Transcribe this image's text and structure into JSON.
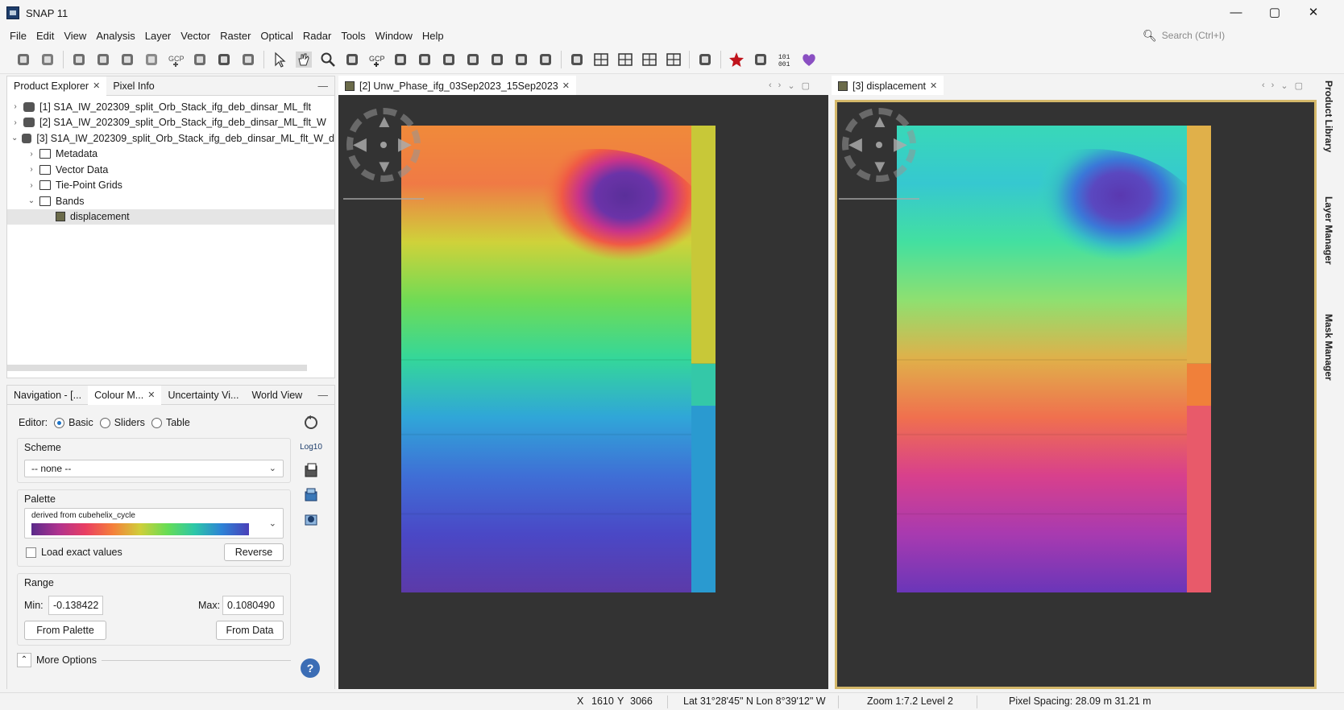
{
  "window": {
    "title": "SNAP 11",
    "controls": [
      "—",
      "▢",
      "✕"
    ]
  },
  "menu": [
    "File",
    "Edit",
    "View",
    "Analysis",
    "Layer",
    "Vector",
    "Raster",
    "Optical",
    "Radar",
    "Tools",
    "Window",
    "Help"
  ],
  "search": {
    "placeholder": "Search (Ctrl+I)"
  },
  "toolbar": {
    "icons": [
      "open-product-icon",
      "save-product-icon",
      "session-icon",
      "graph-builder-icon",
      "batch-processing-icon",
      "layer-icon",
      "gcp-tool-icon",
      "range-finder-icon",
      "graph-icon",
      "pin-icon",
      "select-tool-icon",
      "pan-tool-icon",
      "zoom-tool-icon",
      "pin-placing-icon",
      "gcp-placing-icon",
      "line-tool-icon",
      "polyline-tool-icon",
      "rectangle-tool-icon",
      "polygon-tool-icon",
      "ellipse-tool-icon",
      "magic-wand-icon",
      "range-finder-tool-icon",
      "brush-icon",
      "tile-evenly-icon",
      "tile-horizontal-icon",
      "tile-vertical-icon",
      "tile-single-icon",
      "screenshot-icon",
      "star-icon",
      "sync-cursor-icon",
      "binary-icon",
      "heart-icon"
    ],
    "gcp_label": "GCP"
  },
  "left_top": {
    "tabs": [
      {
        "label": "Product Explorer",
        "closable": true
      },
      {
        "label": "Pixel Info",
        "closable": false
      }
    ],
    "tree": [
      {
        "chev": "›",
        "level": 0,
        "icon": "db",
        "label": "[1] S1A_IW_202309_split_Orb_Stack_ifg_deb_dinsar_ML_flt"
      },
      {
        "chev": "›",
        "level": 0,
        "icon": "db",
        "label": "[2] S1A_IW_202309_split_Orb_Stack_ifg_deb_dinsar_ML_flt_W"
      },
      {
        "chev": "⌄",
        "level": 0,
        "icon": "db",
        "label": "[3] S1A_IW_202309_split_Orb_Stack_ifg_deb_dinsar_ML_flt_W_d"
      },
      {
        "chev": "›",
        "level": 1,
        "icon": "folder",
        "label": "Metadata"
      },
      {
        "chev": "›",
        "level": 1,
        "icon": "folder",
        "label": "Vector Data"
      },
      {
        "chev": "›",
        "level": 1,
        "icon": "folder",
        "label": "Tie-Point Grids"
      },
      {
        "chev": "⌄",
        "level": 1,
        "icon": "folder",
        "label": "Bands"
      },
      {
        "chev": "",
        "level": 2,
        "icon": "band",
        "label": "displacement",
        "selected": true
      }
    ]
  },
  "left_bot": {
    "tabs": [
      {
        "label": "Navigation - [...",
        "active": false,
        "closable": false
      },
      {
        "label": "Colour M...",
        "active": true,
        "closable": true
      },
      {
        "label": "Uncertainty Vi...",
        "active": false,
        "closable": false
      },
      {
        "label": "World View",
        "active": false,
        "closable": false
      }
    ],
    "editor": {
      "label": "Editor:",
      "options": [
        "Basic",
        "Sliders",
        "Table"
      ],
      "selected": "Basic"
    },
    "scheme": {
      "label": "Scheme",
      "value": "-- none --"
    },
    "palette": {
      "label": "Palette",
      "name": "derived from cubehelix_cycle"
    },
    "load_exact": {
      "label": "Load exact values",
      "checked": false
    },
    "reverse_label": "Reverse",
    "range": {
      "label": "Range",
      "min_label": "Min:",
      "min": "-0.138422",
      "max_label": "Max:",
      "max": "0.1080490"
    },
    "from_palette": "From Palette",
    "from_data": "From Data",
    "more_options": "More Options",
    "side_icons": [
      "reset-icon",
      "log10-icon",
      "import-icon",
      "export-icon",
      "apply-icon"
    ],
    "log_label": "Log10",
    "help": "?"
  },
  "views": [
    {
      "tab": "[2] Unw_Phase_ifg_03Sep2023_15Sep2023",
      "palette": "wrap",
      "active": false
    },
    {
      "tab": "[3] displacement",
      "palette": "cube",
      "active": true
    }
  ],
  "right_strip": [
    "Product Library",
    "Layer Manager",
    "Mask Manager"
  ],
  "status": {
    "x_label": "X",
    "x": "1610",
    "y_label": "Y",
    "y": "3066",
    "latlon": "Lat 31°28'45\" N  Lon 8°39'12\" W",
    "zoom": "Zoom 1:7.2  Level 2",
    "spacing": "Pixel Spacing: 28.09 m 31.21 m"
  },
  "colors": {
    "accent": "#1a73c8",
    "view_bg": "#333333",
    "active_border": "#d4b86a"
  }
}
